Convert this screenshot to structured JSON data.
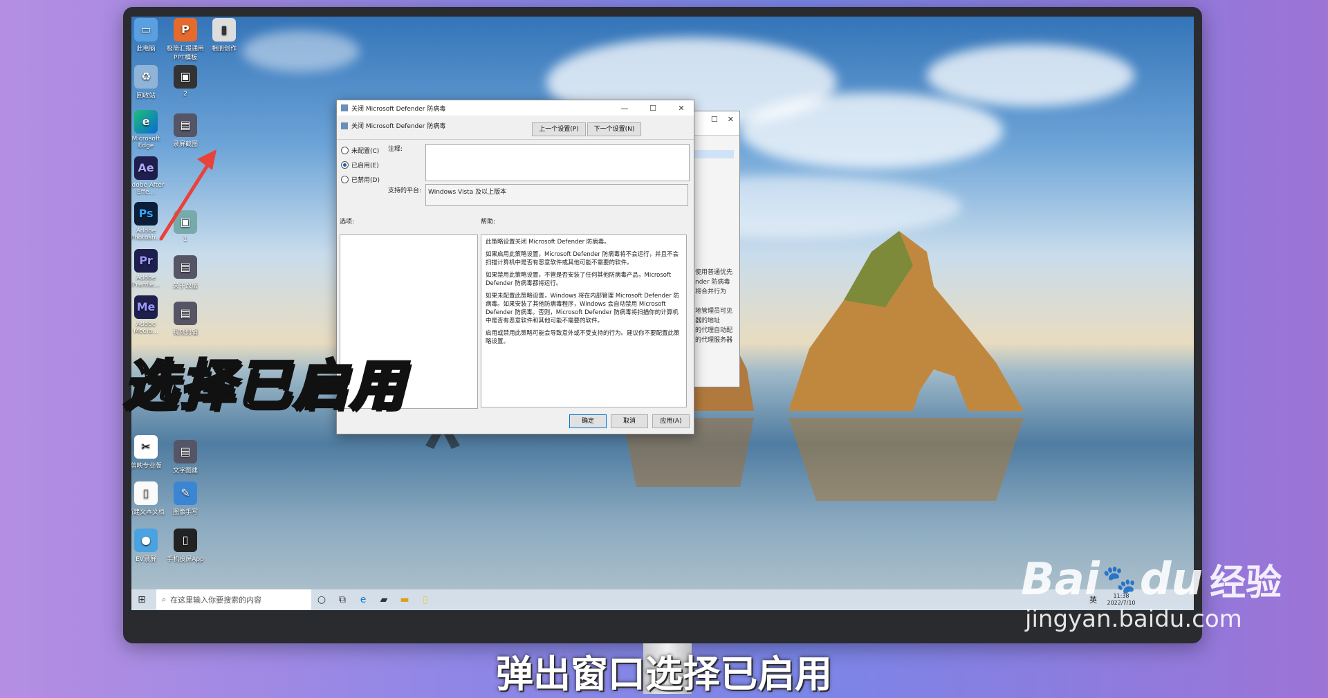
{
  "desktop": {
    "icons": [
      {
        "label": "此电脑",
        "icon": "computer-icon"
      },
      {
        "label": "极简汇报通用PPT模板",
        "icon": "ppt-icon"
      },
      {
        "label": "相册创作",
        "icon": "album-icon"
      },
      {
        "label": "回收站",
        "icon": "recycle-bin-icon"
      },
      {
        "label": "2",
        "icon": "image-icon"
      },
      {
        "label": "Microsoft Edge",
        "icon": "edge-icon"
      },
      {
        "label": "录屏截图",
        "icon": "screen-icon"
      },
      {
        "label": "Adobe After Effe...",
        "icon": "ae-icon",
        "glyph": "Ae"
      },
      {
        "label": "Adobe Photosh...",
        "icon": "ps-icon",
        "glyph": "Ps"
      },
      {
        "label": "1",
        "icon": "image-icon"
      },
      {
        "label": "Adobe Premie...",
        "icon": "pr-icon",
        "glyph": "Pr"
      },
      {
        "label": "关于改版",
        "icon": "screen-icon"
      },
      {
        "label": "Adobe Media...",
        "icon": "me-icon",
        "glyph": "Me"
      },
      {
        "label": "视频剪辑",
        "icon": "screen-icon"
      },
      {
        "label": "剪映专业版",
        "icon": "capcut-icon"
      },
      {
        "label": "文字图建",
        "icon": "screen-icon"
      },
      {
        "label": "新建文本文档",
        "icon": "file-icon"
      },
      {
        "label": "图像手写",
        "icon": "draw-icon"
      },
      {
        "label": "EV录屏",
        "icon": "ev-icon"
      },
      {
        "label": "手机投屏App",
        "icon": "phone-icon"
      }
    ]
  },
  "dialog": {
    "title": "关闭 Microsoft Defender 防病毒",
    "header": "关闭 Microsoft Defender 防病毒",
    "prev_button": "上一个设置(P)",
    "next_button": "下一个设置(N)",
    "radio_not_configured": "未配置(C)",
    "radio_enabled": "已启用(E)",
    "radio_disabled": "已禁用(D)",
    "comment_label": "注释:",
    "platform_label": "支持的平台:",
    "platform_value": "Windows Vista 及以上版本",
    "options_label": "选项:",
    "help_label": "帮助:",
    "help_paragraphs": [
      "此策略设置关闭 Microsoft Defender 防病毒。",
      "如果启用此策略设置，Microsoft Defender 防病毒将不会运行，并且不会扫描计算机中是否有恶意软件或其他可能不需要的软件。",
      "如果禁用此策略设置，不管是否安装了任何其他防病毒产品，Microsoft Defender 防病毒都将运行。",
      "如果未配置此策略设置，Windows 将在内部管理 Microsoft Defender 防病毒。如果安装了其他防病毒程序，Windows 会自动禁用 Microsoft Defender 防病毒。否则，Microsoft Defender 防病毒将扫描你的计算机中是否有恶意软件和其他可能不需要的软件。",
      "启用或禁用此策略可能会导致意外或不受支持的行为。建议你不要配置此策略设置。"
    ],
    "ok_button": "确定",
    "cancel_button": "取消",
    "apply_button": "应用(A)",
    "selected": "enabled"
  },
  "behind_window": {
    "lines": [
      "使用普通优先",
      "nder 防病毒",
      "将合并行为",
      "",
      "地管理员可见",
      "器的地址",
      "的代理自动配",
      "的代理服务器"
    ]
  },
  "taskbar": {
    "search_placeholder": "在这里输入你要搜索的内容",
    "language": "英",
    "time": "11:38",
    "date": "2022/7/10"
  },
  "overlay_text": "选择已启用",
  "subtitle": "弹出窗口选择已启用",
  "watermark": {
    "brand": "Bai",
    "brand2": "du",
    "label": "经验",
    "url": "jingyan.baidu.com"
  },
  "colors": {
    "accent": "#1a5fb4",
    "arrow": "#e8423b"
  }
}
